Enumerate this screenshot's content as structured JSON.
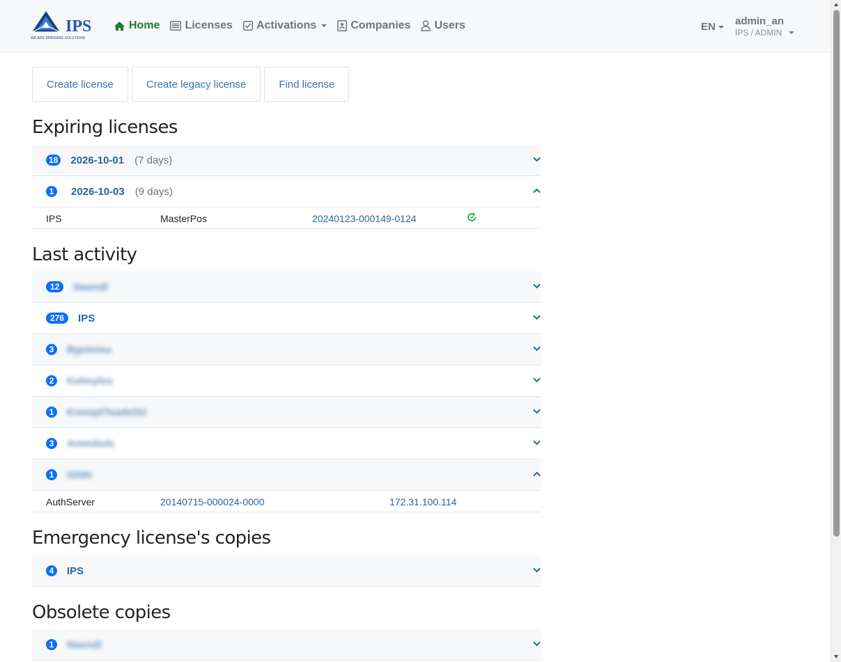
{
  "brand": {
    "logo_text": "IPS",
    "tagline": "WE ARE BRINGING SOLUTIONS"
  },
  "nav": {
    "home": "Home",
    "licenses": "Licenses",
    "activations": "Activations",
    "companies": "Companies",
    "users": "Users"
  },
  "lang": "EN",
  "user": {
    "name": "admin_an",
    "role": "IPS / ADMIN"
  },
  "actions": {
    "create_license": "Create license",
    "create_legacy_license": "Create legacy license",
    "find_license": "Find license"
  },
  "expiring": {
    "title": "Expiring licenses",
    "groups": [
      {
        "count": "18",
        "date": "2026-10-01",
        "note": "(7 days)",
        "expanded": false
      },
      {
        "count": "1",
        "date": "2026-10-03",
        "note": "(9 days)",
        "expanded": true
      }
    ],
    "row": {
      "company": "IPS",
      "product": "MasterPos",
      "license": "20240123-000149-0124"
    }
  },
  "activity": {
    "title": "Last activity",
    "groups": [
      {
        "count": "12",
        "name": "Nasndi",
        "expanded": false
      },
      {
        "count": "276",
        "name": "IPS",
        "expanded": false
      },
      {
        "count": "3",
        "name": "Bgoinisu",
        "expanded": false
      },
      {
        "count": "2",
        "name": "Kelmyles",
        "expanded": false
      },
      {
        "count": "1",
        "name": "KonoptTsadelSt",
        "expanded": false
      },
      {
        "count": "3",
        "name": "Ammituls",
        "expanded": false
      },
      {
        "count": "1",
        "name": "ISNN",
        "expanded": true
      }
    ],
    "row": {
      "product": "AuthServer",
      "license": "20140715-000024-0000",
      "ip": "172.31.100.114"
    }
  },
  "emergency": {
    "title": "Emergency license's copies",
    "groups": [
      {
        "count": "4",
        "name": "IPS",
        "expanded": false
      }
    ]
  },
  "obsolete": {
    "title": "Obsolete copies",
    "groups": [
      {
        "count": "1",
        "name": "Nasndi",
        "expanded": false
      }
    ]
  },
  "colors": {
    "accent": "#0d6efd",
    "link": "#2a6496",
    "active_nav": "#1a7f2e",
    "refresh": "#28a745"
  }
}
